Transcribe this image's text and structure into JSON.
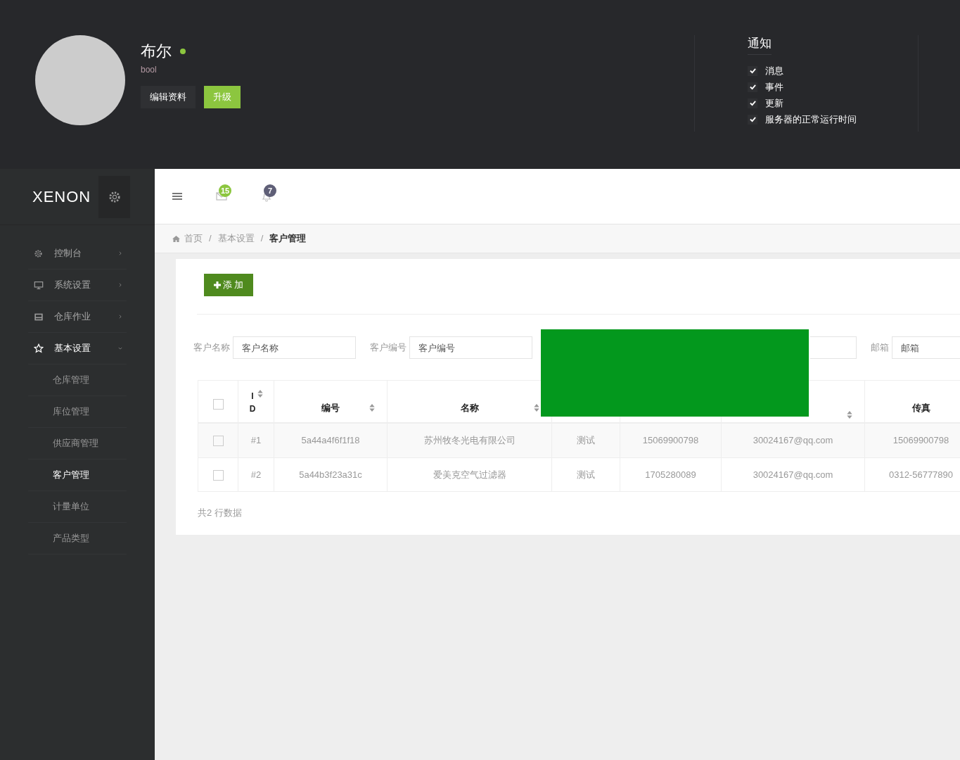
{
  "profile": {
    "name": "布尔",
    "online": true,
    "username": "bool",
    "buttons": [
      {
        "label": "编辑资料",
        "kind": "default"
      },
      {
        "label": "升级",
        "kind": "primary"
      }
    ]
  },
  "notifications": {
    "title": "通知",
    "options": [
      {
        "label": "消息",
        "checked": true
      },
      {
        "label": "事件",
        "checked": true
      },
      {
        "label": "更新",
        "checked": true
      },
      {
        "label": "服务器的正常运行时间",
        "checked": true
      }
    ]
  },
  "sidebar": {
    "logo": "XENON",
    "items": [
      {
        "label": "控制台",
        "kind": "gear",
        "expanded": false,
        "selected": false
      },
      {
        "label": "系统设置",
        "kind": "monitor",
        "expanded": false,
        "selected": false
      },
      {
        "label": "仓库作业",
        "kind": "drive",
        "expanded": false,
        "selected": false
      },
      {
        "label": "基本设置",
        "kind": "star",
        "expanded": true,
        "selected": true,
        "children": [
          {
            "label": "仓库管理",
            "selected": false
          },
          {
            "label": "库位管理",
            "selected": false
          },
          {
            "label": "供应商管理",
            "selected": false
          },
          {
            "label": "客户管理",
            "selected": true
          },
          {
            "label": "计量单位",
            "selected": false
          },
          {
            "label": "产品类型",
            "selected": false
          }
        ]
      }
    ]
  },
  "header": {
    "badges": [
      {
        "kind": "mail",
        "count": "15",
        "color": "#8cc63f"
      },
      {
        "kind": "bell",
        "count": "7",
        "color": "#5f5f77"
      }
    ]
  },
  "breadcrumb": {
    "separator": "/",
    "items": [
      "首页",
      "基本设置",
      "客户管理"
    ]
  },
  "add_button": "添 加",
  "filters": [
    {
      "kind": "labeled",
      "label": "客户名称",
      "placeholder": "客户名称"
    },
    {
      "kind": "labeled",
      "label": "客户编号",
      "placeholder": "客户编号"
    },
    {
      "kind": "covered"
    },
    {
      "kind": "labeled",
      "label": "邮箱",
      "placeholder": "邮箱"
    }
  ],
  "table": {
    "select_all": false,
    "columns": [
      {
        "label": "ID",
        "sortable": true
      },
      {
        "label": "编号",
        "sortable": true
      },
      {
        "label": "名称",
        "sortable": true
      },
      {},
      {},
      {
        "sortable": true
      },
      {
        "label": "传真",
        "sortable": false
      }
    ],
    "rows": [
      {
        "selected": false,
        "cells": [
          "#1",
          "5a44a4f6f1f18",
          "苏州牧冬光电有限公司",
          "测试",
          "15069900798",
          "30024167@qq.com",
          "15069900798"
        ]
      },
      {
        "selected": false,
        "cells": [
          "#2",
          "5a44b3f23a31c",
          "爱美克空气过滤器",
          "测试",
          "1705280089",
          "30024167@qq.com",
          "0312-56777890"
        ]
      }
    ]
  },
  "footer": "共2 行数据"
}
